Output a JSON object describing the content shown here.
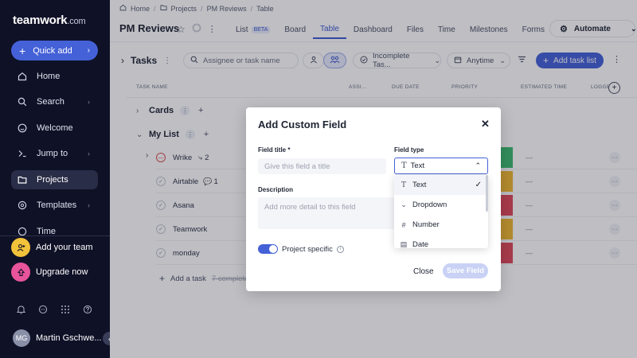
{
  "sidebar": {
    "logo": "teamwork",
    "logo_suffix": ".com",
    "quick_add": "Quick add",
    "items": [
      {
        "label": "Home",
        "icon": "home-icon"
      },
      {
        "label": "Search",
        "icon": "search-icon"
      },
      {
        "label": "Welcome",
        "icon": "smile-icon"
      },
      {
        "label": "Jump to",
        "icon": "jump-icon"
      },
      {
        "label": "Projects",
        "icon": "folder-icon"
      },
      {
        "label": "Templates",
        "icon": "templates-icon"
      },
      {
        "label": "Time",
        "icon": "clock-icon"
      }
    ],
    "promos": [
      {
        "label": "Add your team",
        "color": "#f2c23a"
      },
      {
        "label": "Upgrade now",
        "color": "#e8549c"
      }
    ],
    "user_initials": "MG",
    "user_name": "Martin Gschwe..."
  },
  "breadcrumb": [
    "Home",
    "Projects",
    "PM Reviews",
    "Table"
  ],
  "project": {
    "title": "PM Reviews",
    "tabs": [
      "List",
      "Board",
      "Table",
      "Dashboard",
      "Files",
      "Time",
      "Milestones",
      "Forms"
    ],
    "beta": "BETA",
    "active_tab": "Table",
    "automate": "Automate"
  },
  "toolbar": {
    "title": "Tasks",
    "search_placeholder": "Assignee or task name",
    "filter_status": "Incomplete Tas...",
    "filter_date": "Anytime",
    "add_task_list": "Add task list"
  },
  "table": {
    "columns": [
      "TASK NAME",
      "ASSI...",
      "DUE DATE",
      "PRIORITY",
      "ESTIMATED TIME",
      "LOGGE..."
    ],
    "groups": [
      {
        "name": "Cards"
      },
      {
        "name": "My List"
      }
    ],
    "tasks": [
      {
        "name": "Wrike",
        "subtasks": "2",
        "priority_color": "#3dbb6f"
      },
      {
        "name": "Airtable",
        "comments": "1",
        "priority_color": "#f0b731"
      },
      {
        "name": "Asana",
        "priority_color": "#e04a5a"
      },
      {
        "name": "Teamwork",
        "priority_color": "#f0b731"
      },
      {
        "name": "monday",
        "priority_color": "#e04a5a"
      }
    ],
    "est_placeholder": "—",
    "add_task": "Add a task",
    "completed": "7 completed"
  },
  "modal": {
    "title": "Add Custom Field",
    "field_title_label": "Field title *",
    "field_title_placeholder": "Give this field a title",
    "field_type_label": "Field type",
    "field_type_value": "Text",
    "description_label": "Description",
    "description_placeholder": "Add more detail to this field",
    "options": [
      {
        "label": "Text",
        "icon": "text-icon",
        "selected": true
      },
      {
        "label": "Dropdown",
        "icon": "dropdown-icon"
      },
      {
        "label": "Number",
        "icon": "number-icon"
      },
      {
        "label": "Date",
        "icon": "date-icon"
      }
    ],
    "project_specific": "Project specific",
    "close": "Close",
    "save": "Save Field"
  }
}
